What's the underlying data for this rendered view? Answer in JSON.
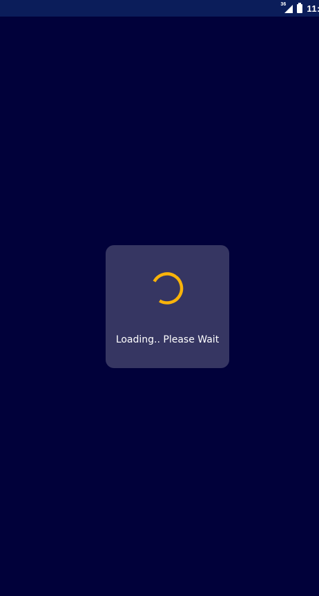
{
  "status_bar": {
    "network_label": "36",
    "clock": "11:",
    "signal_icon": "cellular-signal-icon",
    "battery_icon": "battery-icon"
  },
  "dialog": {
    "message": "Loading.. Please Wait",
    "spinner_icon": "loading-spinner-icon"
  },
  "colors": {
    "background": "#01013a",
    "status_bar": "#0b1d5a",
    "dialog": "#363662",
    "spinner": "#f8b30a",
    "text": "#ffffff"
  }
}
